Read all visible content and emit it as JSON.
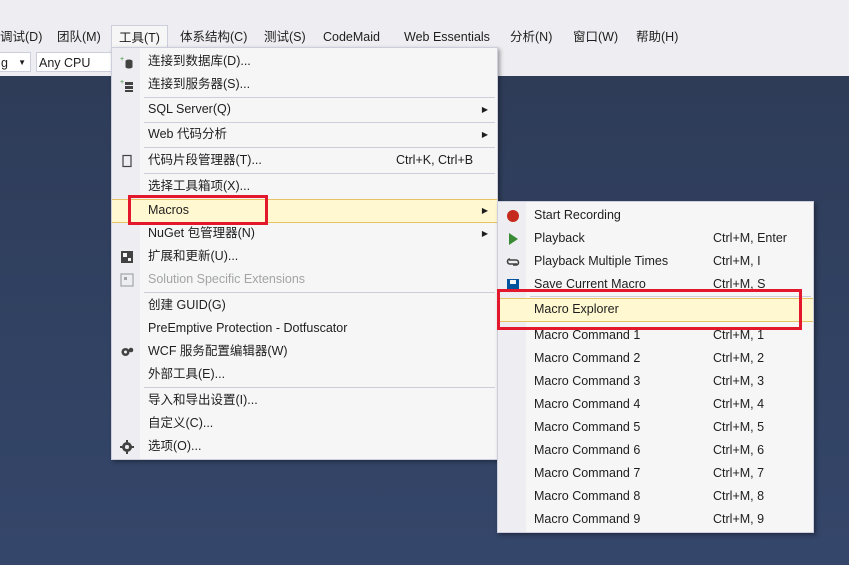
{
  "menubar": {
    "items": [
      "调试(D)",
      "团队(M)",
      "工具(T)",
      "体系结构(C)",
      "测试(S)",
      "CodeMaid",
      "Web Essentials",
      "分析(N)",
      "窗口(W)",
      "帮助(H)"
    ]
  },
  "toolbar": {
    "config_value": "g",
    "platform_value": "Any CPU"
  },
  "tools_menu": {
    "connect_db": "连接到数据库(D)...",
    "connect_server": "连接到服务器(S)...",
    "sql_server": "SQL Server(Q)",
    "web_analysis": "Web 代码分析",
    "snippets": "代码片段管理器(T)...",
    "snippets_shortcut": "Ctrl+K, Ctrl+B",
    "choose_toolbox": "选择工具箱项(X)...",
    "macros": "Macros",
    "nuget": "NuGet 包管理器(N)",
    "extensions": "扩展和更新(U)...",
    "solution_ext": "Solution Specific Extensions",
    "create_guid": "创建 GUID(G)",
    "preemptive": "PreEmptive Protection - Dotfuscator",
    "wcf": "WCF 服务配置编辑器(W)",
    "external_tools": "外部工具(E)...",
    "import_export": "导入和导出设置(I)...",
    "customize": "自定义(C)...",
    "options": "选项(O)..."
  },
  "macros_menu": {
    "start_recording": "Start Recording",
    "playback": "Playback",
    "playback_shortcut": "Ctrl+M, Enter",
    "playback_multi": "Playback Multiple Times",
    "playback_multi_shortcut": "Ctrl+M, I",
    "save_current": "Save Current Macro",
    "save_current_shortcut": "Ctrl+M, S",
    "macro_explorer": "Macro Explorer",
    "commands": [
      {
        "label": "Macro Command 1",
        "shortcut": "Ctrl+M, 1"
      },
      {
        "label": "Macro Command 2",
        "shortcut": "Ctrl+M, 2"
      },
      {
        "label": "Macro Command 3",
        "shortcut": "Ctrl+M, 3"
      },
      {
        "label": "Macro Command 4",
        "shortcut": "Ctrl+M, 4"
      },
      {
        "label": "Macro Command 5",
        "shortcut": "Ctrl+M, 5"
      },
      {
        "label": "Macro Command 6",
        "shortcut": "Ctrl+M, 6"
      },
      {
        "label": "Macro Command 7",
        "shortcut": "Ctrl+M, 7"
      },
      {
        "label": "Macro Command 8",
        "shortcut": "Ctrl+M, 8"
      },
      {
        "label": "Macro Command 9",
        "shortcut": "Ctrl+M, 9"
      }
    ]
  },
  "colors": {
    "highlight": "#fff8d0",
    "annotation_red": "#e4182c",
    "record_red": "#c42b1c",
    "play_green": "#388a34"
  }
}
